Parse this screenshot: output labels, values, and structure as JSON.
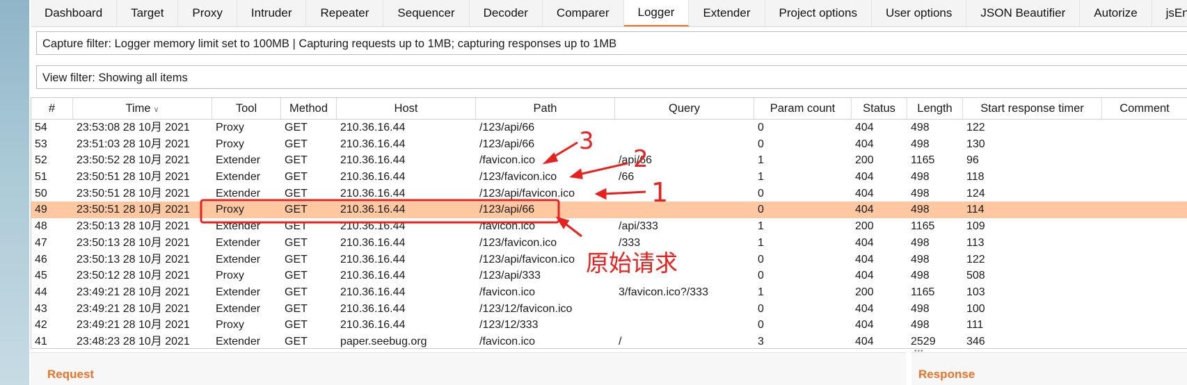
{
  "tabs": [
    "Dashboard",
    "Target",
    "Proxy",
    "Intruder",
    "Repeater",
    "Sequencer",
    "Decoder",
    "Comparer",
    "Logger",
    "Extender",
    "Project options",
    "User options",
    "JSON Beautifier",
    "Autorize",
    "jsEncrypter"
  ],
  "active_tab": "Logger",
  "capture_filter": "Capture filter: Logger memory limit set to 100MB | Capturing requests up to 1MB;  capturing responses up to 1MB",
  "view_filter": "View filter: Showing all items",
  "columns": [
    "#",
    "Time",
    "Tool",
    "Method",
    "Host",
    "Path",
    "Query",
    "Param count",
    "Status",
    "Length",
    "Start response timer",
    "Comment"
  ],
  "sort_icon": "chevron-down-icon",
  "rows": [
    [
      "54",
      "23:53:08 28 10月 2021",
      "Proxy",
      "GET",
      "210.36.16.44",
      "/123/api/66",
      "",
      "0",
      "404",
      "498",
      "122",
      ""
    ],
    [
      "53",
      "23:51:03 28 10月 2021",
      "Proxy",
      "GET",
      "210.36.16.44",
      "/123/api/66",
      "",
      "0",
      "404",
      "498",
      "130",
      ""
    ],
    [
      "52",
      "23:50:52 28 10月 2021",
      "Extender",
      "GET",
      "210.36.16.44",
      "/favicon.ico",
      "/api/66",
      "1",
      "200",
      "1165",
      "96",
      ""
    ],
    [
      "51",
      "23:50:51 28 10月 2021",
      "Extender",
      "GET",
      "210.36.16.44",
      "/123/favicon.ico",
      "/66",
      "1",
      "404",
      "498",
      "118",
      ""
    ],
    [
      "50",
      "23:50:51 28 10月 2021",
      "Extender",
      "GET",
      "210.36.16.44",
      "/123/api/favicon.ico",
      "",
      "0",
      "404",
      "498",
      "124",
      ""
    ],
    [
      "49",
      "23:50:51 28 10月 2021",
      "Proxy",
      "GET",
      "210.36.16.44",
      "/123/api/66",
      "",
      "0",
      "404",
      "498",
      "114",
      ""
    ],
    [
      "48",
      "23:50:13 28 10月 2021",
      "Extender",
      "GET",
      "210.36.16.44",
      "/favicon.ico",
      "/api/333",
      "1",
      "200",
      "1165",
      "109",
      ""
    ],
    [
      "47",
      "23:50:13 28 10月 2021",
      "Extender",
      "GET",
      "210.36.16.44",
      "/123/favicon.ico",
      "/333",
      "1",
      "404",
      "498",
      "113",
      ""
    ],
    [
      "46",
      "23:50:13 28 10月 2021",
      "Extender",
      "GET",
      "210.36.16.44",
      "/123/api/favicon.ico",
      "",
      "0",
      "404",
      "498",
      "122",
      ""
    ],
    [
      "45",
      "23:50:12 28 10月 2021",
      "Proxy",
      "GET",
      "210.36.16.44",
      "/123/api/333",
      "",
      "0",
      "404",
      "498",
      "508",
      ""
    ],
    [
      "44",
      "23:49:21 28 10月 2021",
      "Extender",
      "GET",
      "210.36.16.44",
      "/favicon.ico",
      "3/favicon.ico?/333",
      "1",
      "200",
      "1165",
      "103",
      ""
    ],
    [
      "43",
      "23:49:21 28 10月 2021",
      "Extender",
      "GET",
      "210.36.16.44",
      "/123/12/favicon.ico",
      "",
      "0",
      "404",
      "498",
      "100",
      ""
    ],
    [
      "42",
      "23:49:21 28 10月 2021",
      "Proxy",
      "GET",
      "210.36.16.44",
      "/123/12/333",
      "",
      "0",
      "404",
      "498",
      "111",
      ""
    ],
    [
      "41",
      "23:48:23 28 10月 2021",
      "Extender",
      "GET",
      "paper.seebug.org",
      "/favicon.ico",
      "/",
      "3",
      "404",
      "2529",
      "346",
      ""
    ]
  ],
  "highlighted_row": "49",
  "panels": {
    "request": "Request",
    "response": "Response"
  },
  "splitter": "•••",
  "annotations": {
    "one": "1",
    "two": "2",
    "three": "3",
    "original": "原始请求",
    "color": "#e8201e"
  },
  "colors": {
    "accent": "#e8732a",
    "highlight": "#ffc8a0"
  }
}
